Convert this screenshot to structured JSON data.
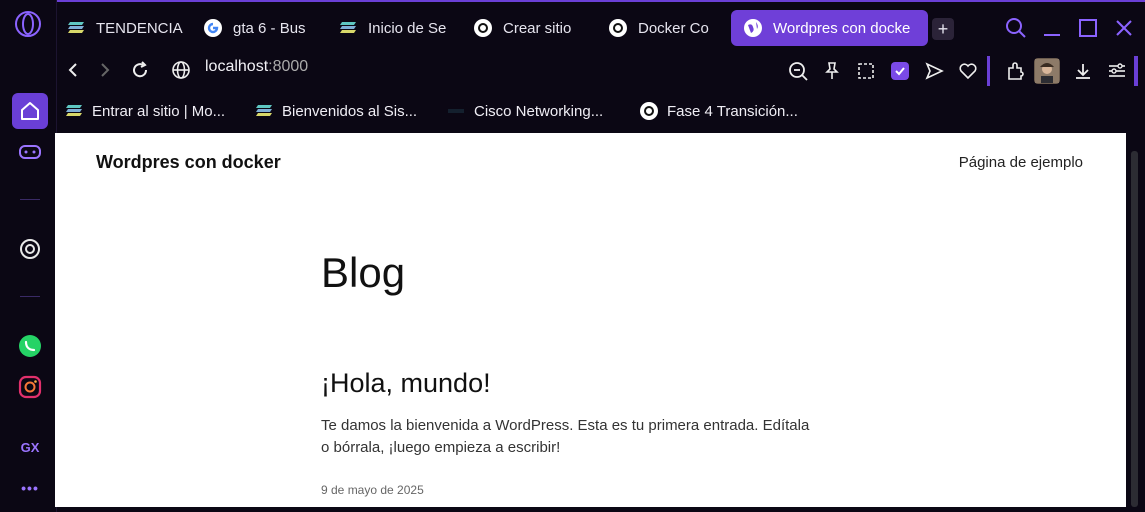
{
  "colors": {
    "accent": "#6f3fd8",
    "frame": "#0b0714"
  },
  "sidebar": {
    "items": [
      {
        "icon": "home-icon"
      },
      {
        "icon": "gamepad-icon"
      },
      {
        "icon": "chatgpt-icon"
      },
      {
        "icon": "whatsapp-icon"
      },
      {
        "icon": "instagram-icon"
      },
      {
        "label": "GX"
      },
      {
        "icon": "more-icon"
      }
    ],
    "gx_label": "GX",
    "more_label": "•••"
  },
  "tabs": [
    {
      "label": "TENDENCIA",
      "icon": "stack-icon"
    },
    {
      "label": "gta 6 - Bus",
      "icon": "google-icon"
    },
    {
      "label": "Inicio de Se",
      "icon": "stack-icon"
    },
    {
      "label": "Crear sitio",
      "icon": "chatgpt-icon"
    },
    {
      "label": "Docker Co",
      "icon": "chatgpt-icon"
    },
    {
      "label": "Wordpres con docke",
      "icon": "globe-icon",
      "active": true
    }
  ],
  "new_tab_label": "+",
  "address": {
    "url_host": "localhost",
    "url_port": ":8000"
  },
  "bookmarks": [
    {
      "label": "Entrar al sitio | Mo...",
      "icon": "stack-icon"
    },
    {
      "label": "Bienvenidos al Sis...",
      "icon": "stack-icon"
    },
    {
      "label": "Cisco Networking...",
      "icon": "cisco-icon"
    },
    {
      "label": "Fase 4 Transición...",
      "icon": "chatgpt-icon"
    }
  ],
  "page": {
    "site_title": "Wordpres con docker",
    "nav_link": "Página de ejemplo",
    "heading": "Blog",
    "post_title": "¡Hola, mundo!",
    "post_excerpt": "Te damos la bienvenida a WordPress. Esta es tu primera entrada. Edítala o bórrala, ¡luego empieza a escribir!",
    "post_date": "9 de mayo de 2025"
  }
}
